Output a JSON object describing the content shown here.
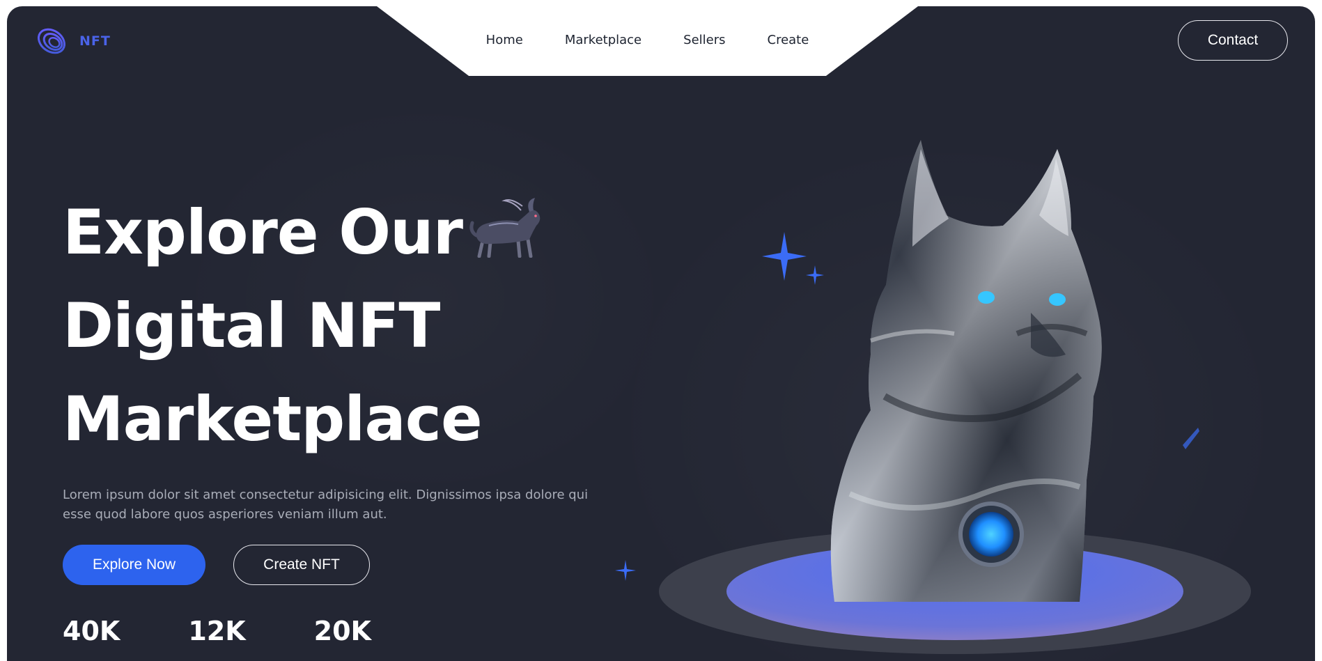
{
  "brand": {
    "logo_text": "NFT",
    "accent": "#4a63e8"
  },
  "nav": {
    "links": [
      "Home",
      "Marketplace",
      "Sellers",
      "Create"
    ],
    "contact_label": "Contact"
  },
  "hero": {
    "headline_lines": [
      "Explore Our",
      "Digital NFT",
      "Marketplace"
    ],
    "description": "Lorem ipsum dolor sit amet consectetur adipisicing elit. Dignissimos ipsa dolore qui esse quod labore quos asperiores veniam illum aut.",
    "primary_button": "Explore Now",
    "secondary_button": "Create NFT",
    "stats": [
      "40K",
      "12K",
      "20K"
    ]
  },
  "colors": {
    "background": "#232633",
    "primary_button": "#2d63ee",
    "sparkle": "#3b6cf6",
    "platform_top": "#5b6fe6",
    "platform_bottom": "#8a78c2"
  },
  "icons": {
    "logo": "swirl-logo-icon",
    "headline_image": "wolf-image",
    "artwork": "chrome-dog-sculpture"
  }
}
